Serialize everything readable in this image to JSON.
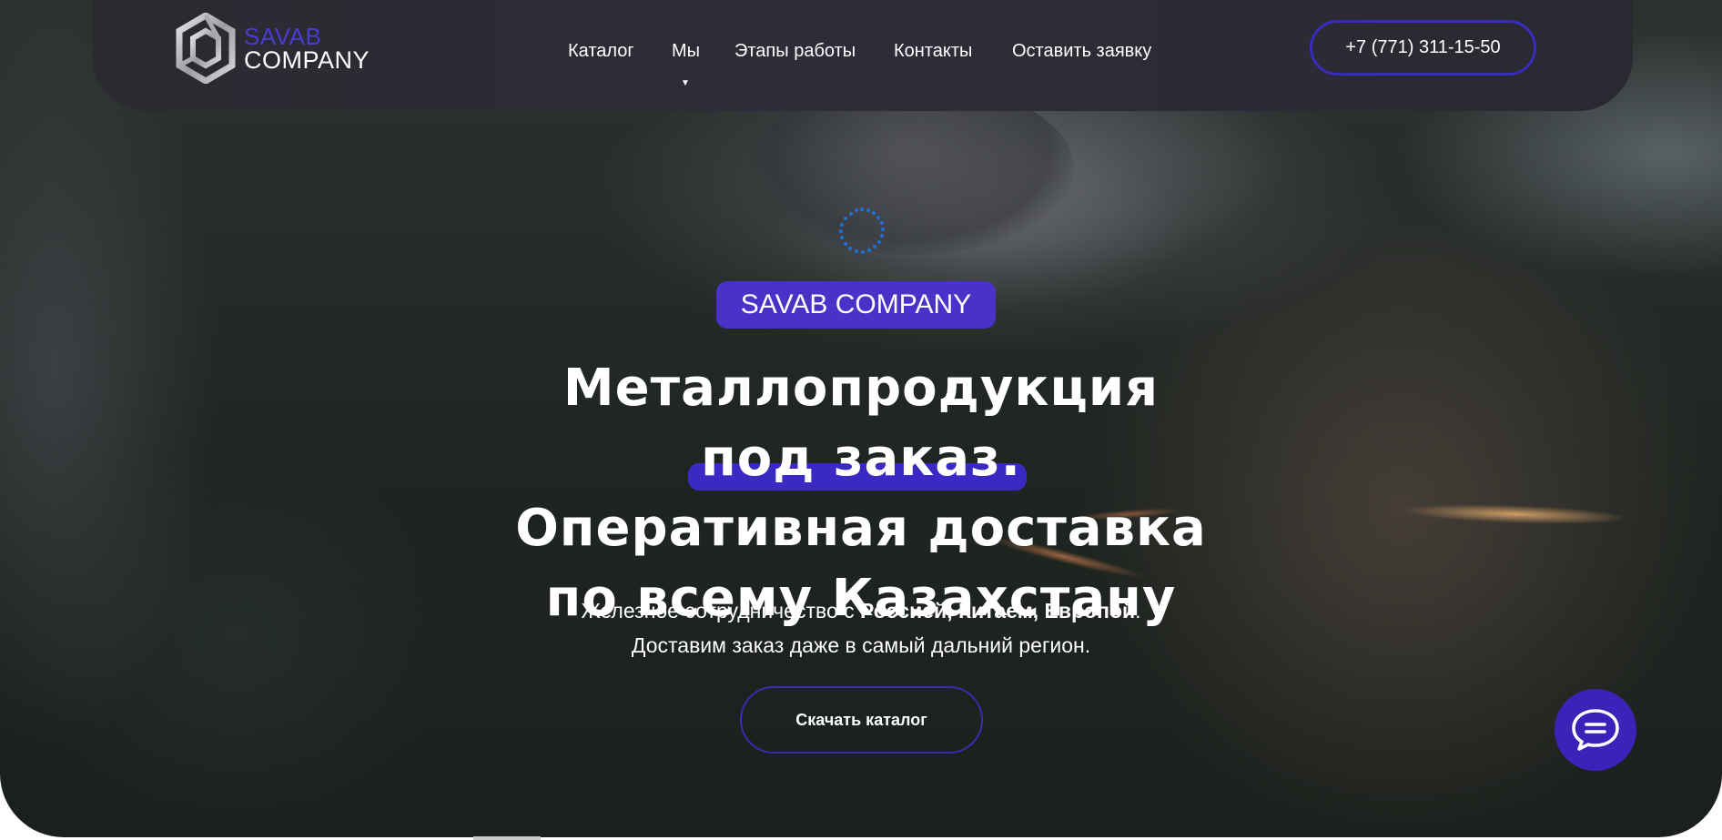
{
  "logo": {
    "line1": "SAVAB",
    "line2": "COMPANY",
    "icon": "hexagon-logo-icon"
  },
  "nav": {
    "items": [
      {
        "label": "Каталог"
      },
      {
        "label": "Мы",
        "has_dropdown": true
      },
      {
        "label": "Этапы работы"
      },
      {
        "label": "Контакты"
      },
      {
        "label": "Оставить заявку"
      }
    ],
    "caret": "▼",
    "phone": "+7 (771) 311-15-50"
  },
  "hero": {
    "badge": "SAVAB COMPANY",
    "headline": {
      "line1_a": "Металлопродукция ",
      "line1_highlight": "под заказ.",
      "line2": "Оперативная доставка",
      "line3": "по всему Казахстану"
    },
    "subtitle": {
      "line1_a": "Железное сотрудничество с ",
      "line1_bold": "Россией, Китаем, Европой",
      "line1_end": ".",
      "line2": "Доставим заказ даже в самый дальний регион."
    },
    "cta_label": "Скачать каталог"
  },
  "colors": {
    "accent": "#4a32c8",
    "navbar_bg": "#2c2b33",
    "chat_button": "#3b22b8",
    "spinner": "#1e6fd8"
  },
  "icons": {
    "chat": "chat-bubble-icon",
    "loading": "loading-spinner-icon"
  }
}
